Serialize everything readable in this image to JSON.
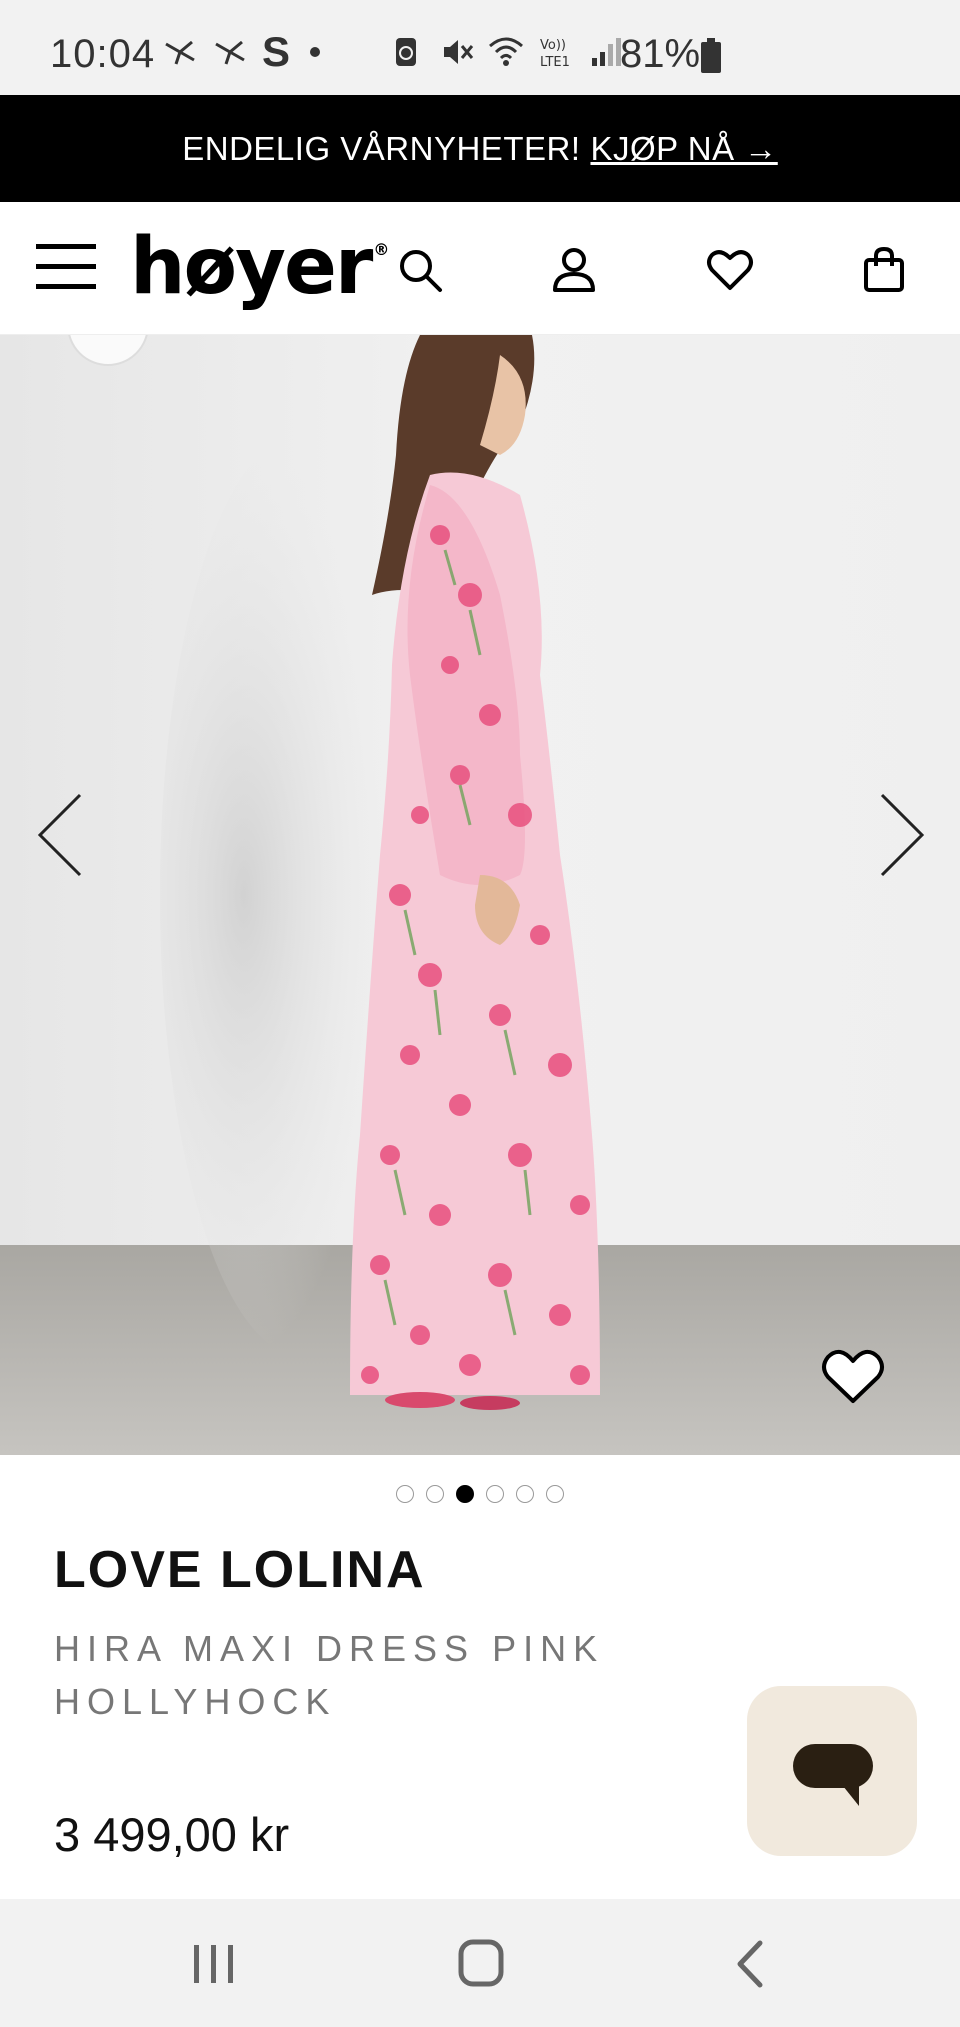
{
  "status_bar": {
    "time": "10:04",
    "battery": "81%",
    "left_icons": [
      "bird-icon",
      "bird-icon",
      "s-app-icon",
      "dot-icon"
    ],
    "right_icons": [
      "recycle-icon",
      "mute-icon",
      "wifi-icon",
      "volte-icon",
      "signal-icon",
      "battery-icon"
    ]
  },
  "promo": {
    "text": "ENDELIG VÅRNYHETER!",
    "link": "KJØP NÅ →"
  },
  "header": {
    "logo": "høyer",
    "icons": [
      "menu-icon",
      "search-icon",
      "account-icon",
      "wishlist-heart-icon",
      "cart-bag-icon"
    ]
  },
  "gallery": {
    "slide_count": 6,
    "active_slide": 3,
    "arrows": [
      "chevron-left-icon",
      "chevron-right-icon"
    ]
  },
  "product": {
    "brand": "LOVE LOLINA",
    "title": "HIRA MAXI DRESS PINK HOLLYHOCK",
    "price": "3 499,00 kr"
  },
  "colors": {
    "banner_bg": "#000000",
    "chat_bg": "#f1e9dd",
    "dress_pink": "#f2a0b8",
    "floor": "#b9b7b3"
  }
}
